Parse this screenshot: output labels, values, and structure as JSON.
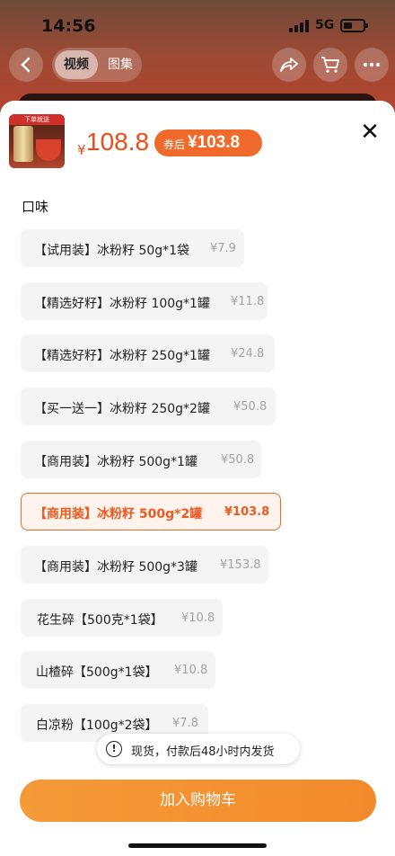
{
  "status_bar": {
    "time": "14:56",
    "network": "5G"
  },
  "media_tabs": {
    "video": "视频",
    "gallery": "图集"
  },
  "thumbnail": {
    "badge": "下单就送"
  },
  "product": {
    "currency": "¥",
    "price": "108.8",
    "coupon_label": "券后",
    "coupon_price": "¥103.8"
  },
  "close_symbol": "✕",
  "section_title": "口味",
  "options": [
    {
      "name": "【试用装】冰粉籽 50g*1袋",
      "price": "¥7.9",
      "selected": false
    },
    {
      "name": "【精选好籽】冰粉籽 100g*1罐",
      "price": "¥11.8",
      "selected": false
    },
    {
      "name": "【精选好籽】冰粉籽 250g*1罐",
      "price": "¥24.8",
      "selected": false
    },
    {
      "name": "【买一送一】冰粉籽 250g*2罐",
      "price": "¥50.8",
      "selected": false
    },
    {
      "name": "【商用装】冰粉籽 500g*1罐",
      "price": "¥50.8",
      "selected": false
    },
    {
      "name": "【商用装】冰粉籽 500g*2罐",
      "price": "¥103.8",
      "selected": true
    },
    {
      "name": "【商用装】冰粉籽 500g*3罐",
      "price": "¥153.8",
      "selected": false
    },
    {
      "name": "花生碎【500克*1袋】",
      "price": "¥10.8",
      "selected": false
    },
    {
      "name": "山楂碎【500g*1袋】",
      "price": "¥10.8",
      "selected": false
    },
    {
      "name": "白凉粉【100g*2袋】",
      "price": "¥7.8",
      "selected": false
    }
  ],
  "notice": {
    "text": "现货，付款后48小时内发货"
  },
  "add_to_cart": "加入购物车",
  "colors": {
    "accent": "#f06a2c",
    "price": "#f04a18",
    "button": "#f59a38"
  },
  "icons": [
    "back-arrow-icon",
    "share-icon",
    "cart-icon",
    "more-icon",
    "close-icon",
    "info-icon"
  ]
}
